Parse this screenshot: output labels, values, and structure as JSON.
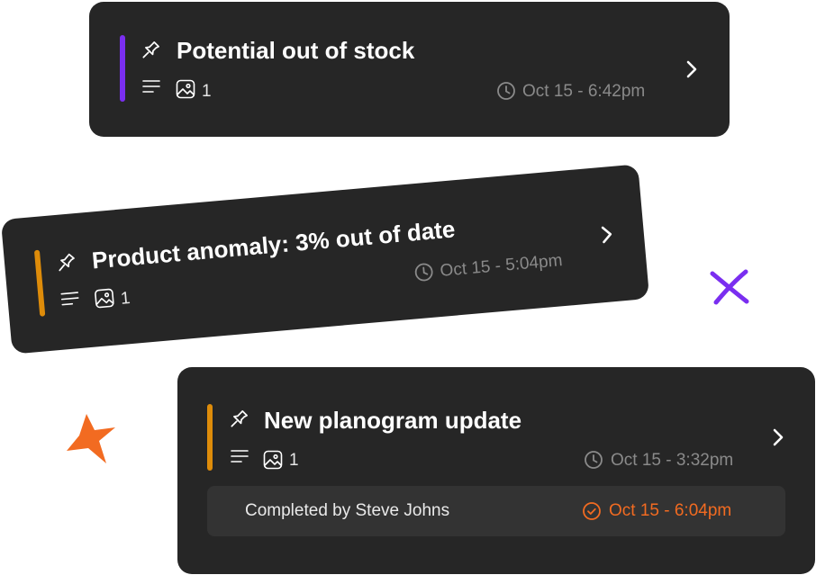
{
  "colors": {
    "purple": "#7a2ef0",
    "amber": "#de8c0a",
    "orange": "#f26b21",
    "card_bg": "#262626"
  },
  "cards": [
    {
      "title": "Potential out of stock",
      "image_count": "1",
      "time": "Oct 15 - 6:42pm",
      "accent": "purple"
    },
    {
      "title": "Product anomaly: 3% out of date",
      "image_count": "1",
      "time": "Oct 15 - 5:04pm",
      "accent": "amber"
    },
    {
      "title": "New planogram update",
      "image_count": "1",
      "time": "Oct 15 - 3:32pm",
      "accent": "amber",
      "completed_by": "Completed by Steve Johns",
      "completed_time": "Oct 15 - 6:04pm"
    }
  ],
  "decorations": {
    "cross_icon": "purple",
    "star_icon": "orange"
  }
}
